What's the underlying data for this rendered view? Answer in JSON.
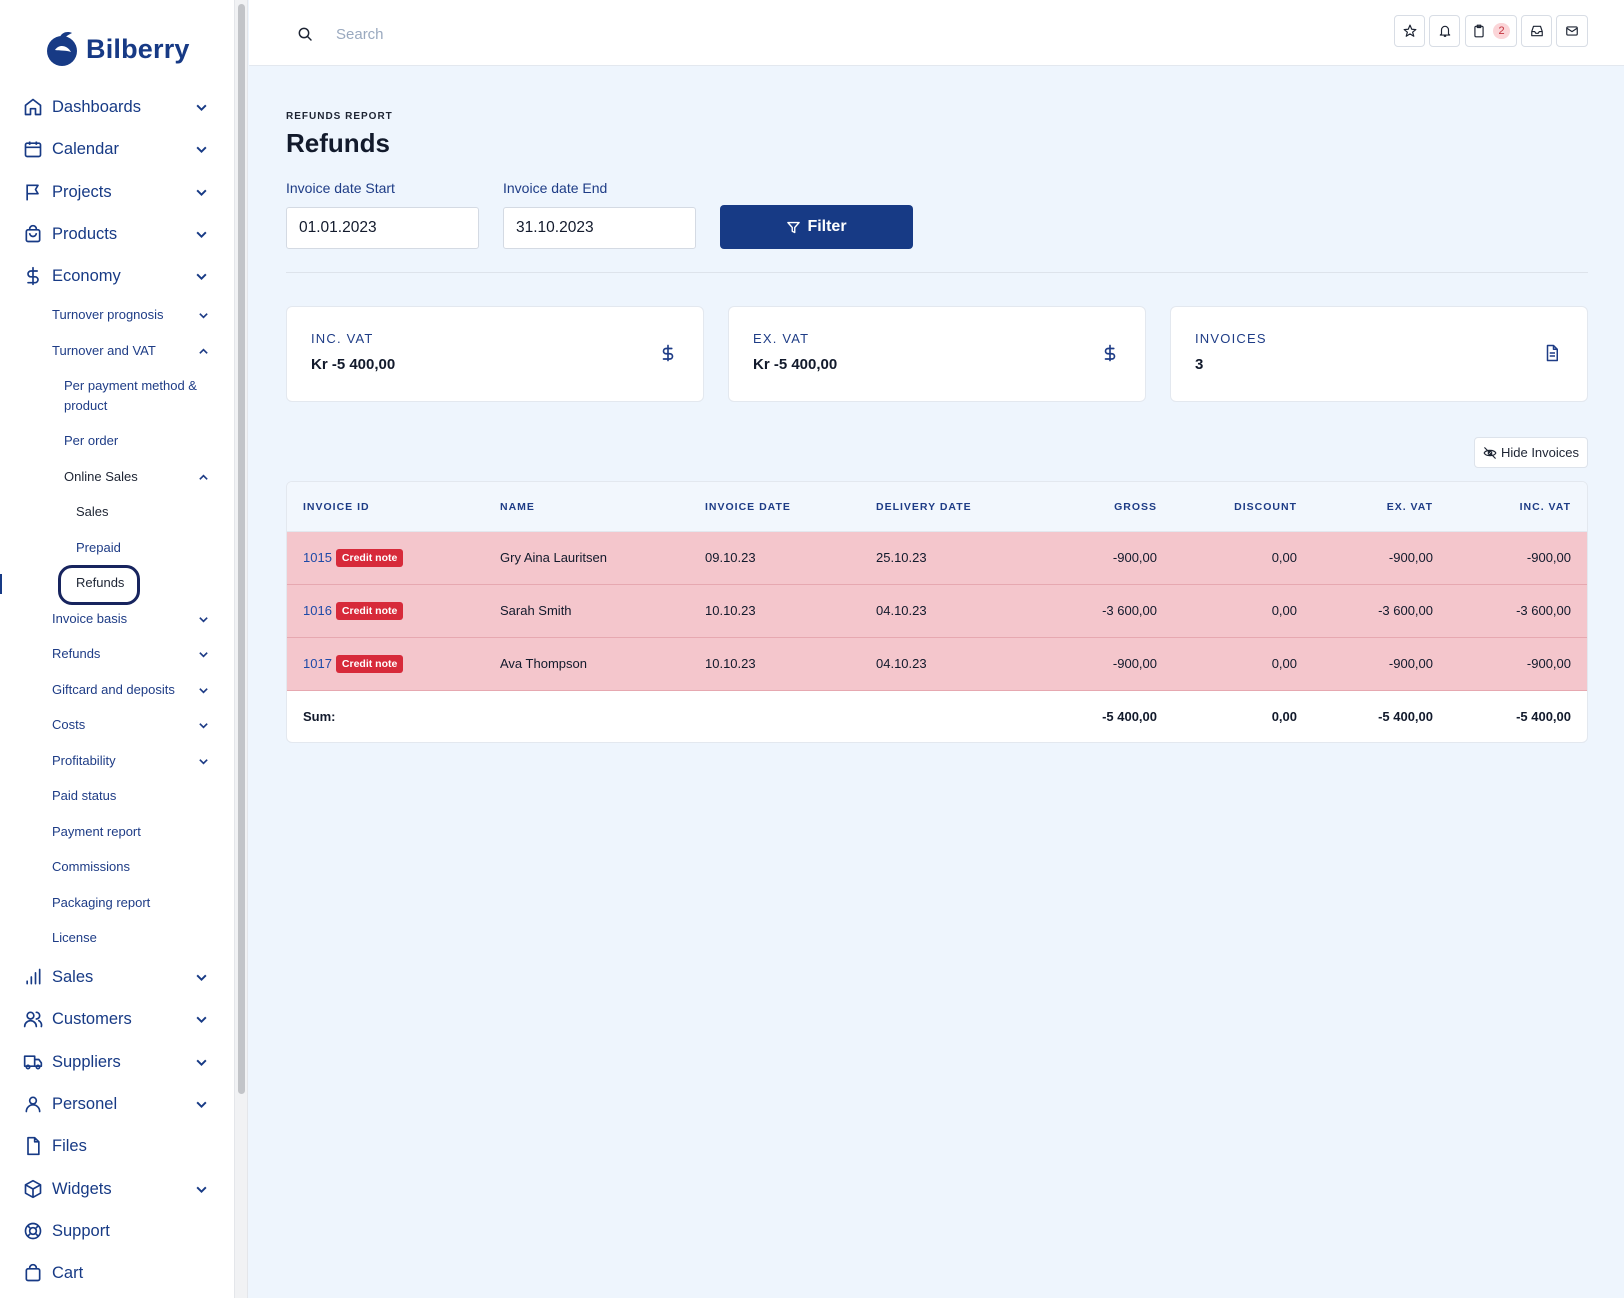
{
  "brand": {
    "name": "Bilberry"
  },
  "sidebar": {
    "top": [
      {
        "label": "Dashboards",
        "icon": "home-icon",
        "expandable": true
      },
      {
        "label": "Calendar",
        "icon": "calendar-icon",
        "expandable": true
      },
      {
        "label": "Projects",
        "icon": "flag-icon",
        "expandable": true
      },
      {
        "label": "Products",
        "icon": "shopping-bag-icon",
        "expandable": true
      },
      {
        "label": "Economy",
        "icon": "dollar-icon",
        "expandable": true
      }
    ],
    "economy": [
      {
        "label": "Turnover prognosis",
        "chevron": "down"
      },
      {
        "label": "Turnover and VAT",
        "chevron": "up"
      },
      {
        "label": "Per payment method & product"
      },
      {
        "label": "Per order"
      },
      {
        "label": "Online Sales",
        "chevron": "up"
      },
      {
        "label": "Sales"
      },
      {
        "label": "Prepaid"
      },
      {
        "label": "Refunds",
        "active": true
      },
      {
        "label": "Invoice basis",
        "chevron": "down"
      },
      {
        "label": "Refunds",
        "chevron": "down"
      },
      {
        "label": "Giftcard and deposits",
        "chevron": "down"
      },
      {
        "label": "Costs",
        "chevron": "down"
      },
      {
        "label": "Profitability",
        "chevron": "down"
      },
      {
        "label": "Paid status"
      },
      {
        "label": "Payment report"
      },
      {
        "label": "Commissions"
      },
      {
        "label": "Packaging report"
      },
      {
        "label": "License"
      }
    ],
    "bottom": [
      {
        "label": "Sales",
        "icon": "bar-chart-icon",
        "expandable": true
      },
      {
        "label": "Customers",
        "icon": "users-icon",
        "expandable": true
      },
      {
        "label": "Suppliers",
        "icon": "truck-icon",
        "expandable": true
      },
      {
        "label": "Personel",
        "icon": "user-icon",
        "expandable": true
      },
      {
        "label": "Files",
        "icon": "file-icon",
        "expandable": false
      },
      {
        "label": "Widgets",
        "icon": "cube-icon",
        "expandable": true
      },
      {
        "label": "Support",
        "icon": "lifebuoy-icon",
        "expandable": false
      },
      {
        "label": "Cart",
        "icon": "cart-icon",
        "expandable": false
      }
    ]
  },
  "header": {
    "search_placeholder": "Search",
    "clipboard_count": "2"
  },
  "page": {
    "eyebrow": "REFUNDS REPORT",
    "title": "Refunds",
    "start_label": "Invoice date Start",
    "start_value": "01.01.2023",
    "end_label": "Invoice date End",
    "end_value": "31.10.2023",
    "filter_label": "Filter"
  },
  "cards": [
    {
      "label": "INC. VAT",
      "value": "Kr -5 400,00",
      "icon": "dollar-icon"
    },
    {
      "label": "EX. VAT",
      "value": "Kr -5 400,00",
      "icon": "dollar-icon"
    },
    {
      "label": "INVOICES",
      "value": "3",
      "icon": "document-icon"
    }
  ],
  "hide_invoices_label": "Hide Invoices",
  "table": {
    "columns": [
      "INVOICE ID",
      "NAME",
      "INVOICE DATE",
      "DELIVERY DATE",
      "GROSS",
      "DISCOUNT",
      "EX. VAT",
      "INC. VAT"
    ],
    "badge": "Credit note",
    "rows": [
      {
        "id": "1015",
        "name": "Gry Aina Lauritsen",
        "invoice_date": "09.10.23",
        "delivery_date": "25.10.23",
        "gross": "-900,00",
        "discount": "0,00",
        "ex_vat": "-900,00",
        "inc_vat": "-900,00"
      },
      {
        "id": "1016",
        "name": "Sarah Smith",
        "invoice_date": "10.10.23",
        "delivery_date": "04.10.23",
        "gross": "-3 600,00",
        "discount": "0,00",
        "ex_vat": "-3 600,00",
        "inc_vat": "-3 600,00"
      },
      {
        "id": "1017",
        "name": "Ava Thompson",
        "invoice_date": "10.10.23",
        "delivery_date": "04.10.23",
        "gross": "-900,00",
        "discount": "0,00",
        "ex_vat": "-900,00",
        "inc_vat": "-900,00"
      }
    ],
    "sum": {
      "label": "Sum:",
      "gross": "-5 400,00",
      "discount": "0,00",
      "ex_vat": "-5 400,00",
      "inc_vat": "-5 400,00"
    }
  },
  "colors": {
    "brand": "#173a85",
    "credit_badge": "#d72a3a",
    "row_highlight": "#f4c6cc",
    "background": "#eef5fd"
  }
}
